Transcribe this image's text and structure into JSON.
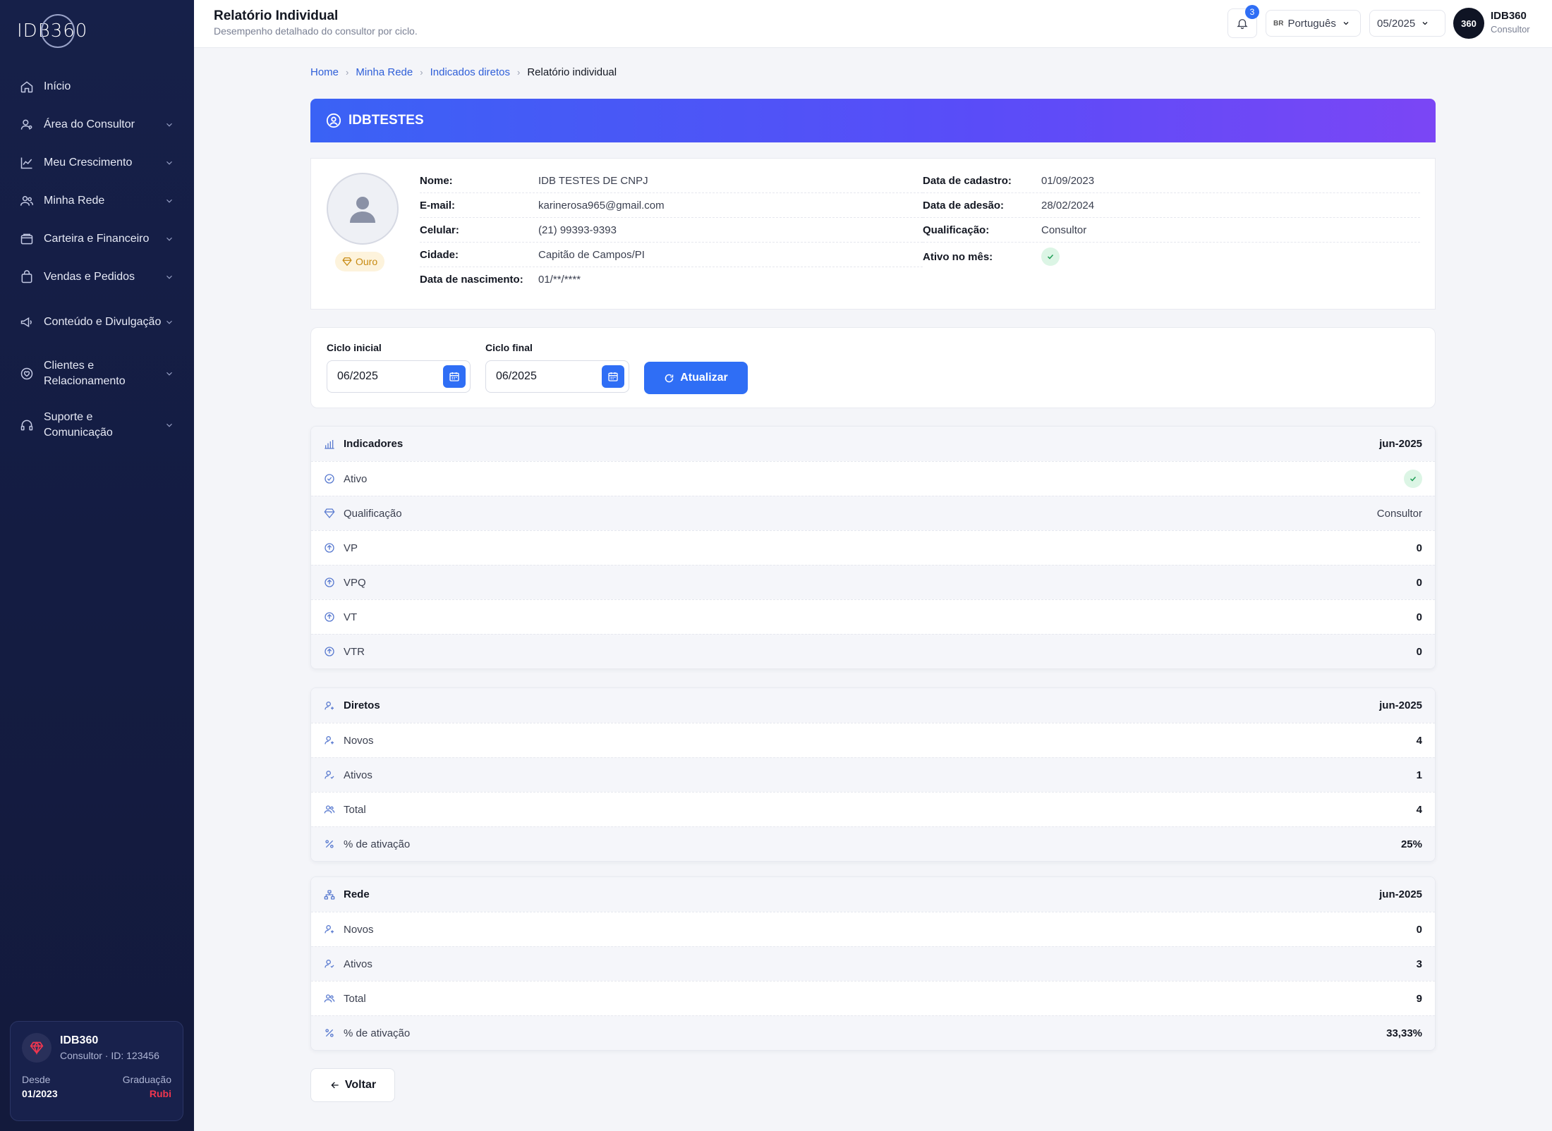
{
  "sidebar": {
    "logo": "IDB360",
    "items": [
      {
        "label": "Início",
        "icon": "home-icon"
      },
      {
        "label": "Área do Consultor",
        "icon": "user-icon"
      },
      {
        "label": "Meu Crescimento",
        "icon": "trend-icon"
      },
      {
        "label": "Minha Rede",
        "icon": "users-icon"
      },
      {
        "label": "Carteira e Financeiro",
        "icon": "wallet-icon"
      },
      {
        "label": "Vendas e Pedidos",
        "icon": "bag-icon"
      },
      {
        "label": "Conteúdo e Divulgação",
        "icon": "megaphone-icon"
      },
      {
        "label": "Clientes e Relacionamento",
        "icon": "heart-chat-icon"
      },
      {
        "label": "Suporte e Comunicação",
        "icon": "headset-icon"
      }
    ],
    "user_card": {
      "name": "IDB360",
      "subtitle": "Consultor · ID: 123456",
      "since_label": "Desde",
      "since_value": "01/2023",
      "grad_label": "Graduação",
      "grad_value": "Rubi"
    }
  },
  "topbar": {
    "title": "Relatório Individual",
    "subtitle": "Desempenho detalhado do consultor por ciclo.",
    "notif_count": "3",
    "language_flag": "BR",
    "language": "Português",
    "period": "05/2025",
    "avatar_text": "360",
    "user_name": "IDB360",
    "user_role": "Consultor"
  },
  "breadcrumb": {
    "items": [
      "Home",
      "Minha Rede",
      "Indicados diretos"
    ],
    "current": "Relatório individual"
  },
  "profile": {
    "header": "IDBTESTES",
    "badge": "Ouro",
    "left": [
      {
        "label": "Nome:",
        "value": "IDB TESTES DE CNPJ"
      },
      {
        "label": "E-mail:",
        "value": "karinerosa965@gmail.com"
      },
      {
        "label": "Celular:",
        "value": "(21) 99393-9393"
      },
      {
        "label": "Cidade:",
        "value": "Capitão de Campos/PI"
      },
      {
        "label": "Data de nascimento:",
        "value": "01/**/****"
      }
    ],
    "right": [
      {
        "label": "Data de cadastro:",
        "value": "01/09/2023"
      },
      {
        "label": "Data de adesão:",
        "value": "28/02/2024"
      },
      {
        "label": "Qualificação:",
        "value": "Consultor"
      },
      {
        "label": "Ativo no mês:",
        "value": ""
      }
    ]
  },
  "filter": {
    "start_label": "Ciclo inicial",
    "start_value": "06/2025",
    "end_label": "Ciclo final",
    "end_value": "06/2025",
    "update_label": "Atualizar"
  },
  "indicadores": {
    "title": "Indicadores",
    "period": "jun-2025",
    "rows": [
      {
        "label": "Ativo",
        "value": ""
      },
      {
        "label": "Qualificação",
        "value": "Consultor"
      },
      {
        "label": "VP",
        "value": "0"
      },
      {
        "label": "VPQ",
        "value": "0"
      },
      {
        "label": "VT",
        "value": "0"
      },
      {
        "label": "VTR",
        "value": "0"
      }
    ]
  },
  "diretos": {
    "title": "Diretos",
    "period": "jun-2025",
    "rows": [
      {
        "label": "Novos",
        "value": "4"
      },
      {
        "label": "Ativos",
        "value": "1"
      },
      {
        "label": "Total",
        "value": "4"
      },
      {
        "label": "% de ativação",
        "value": "25%"
      }
    ]
  },
  "rede": {
    "title": "Rede",
    "period": "jun-2025",
    "rows": [
      {
        "label": "Novos",
        "value": "0"
      },
      {
        "label": "Ativos",
        "value": "3"
      },
      {
        "label": "Total",
        "value": "9"
      },
      {
        "label": "% de ativação",
        "value": "33,33%"
      }
    ]
  },
  "back_label": "Voltar",
  "colors": {
    "accent": "#2f6ef5",
    "sidebar": "#162049",
    "hero_start": "#3a62f5",
    "hero_end": "#7b46f5",
    "rubi": "#f0364f",
    "gold": "#c78a12"
  }
}
